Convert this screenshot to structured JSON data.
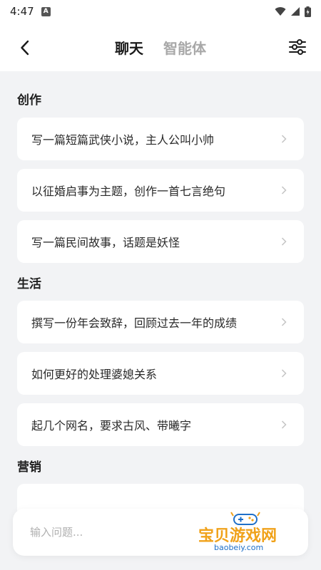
{
  "status_bar": {
    "time": "4:47",
    "sim_badge": "A"
  },
  "header": {
    "tabs": [
      {
        "label": "聊天",
        "active": true
      },
      {
        "label": "智能体",
        "active": false
      }
    ]
  },
  "sections": [
    {
      "title": "创作",
      "items": [
        "写一篇短篇武侠小说，主人公叫小帅",
        "以征婚启事为主题，创作一首七言绝句",
        "写一篇民间故事，话题是妖怪"
      ]
    },
    {
      "title": "生活",
      "items": [
        "撰写一份年会致辞，回顾过去一年的成绩",
        "如何更好的处理婆媳关系",
        "起几个网名，要求古风、带曦字"
      ]
    },
    {
      "title": "营销",
      "items": []
    }
  ],
  "input": {
    "placeholder": "输入问题..."
  },
  "watermark": {
    "title": "宝贝游戏网",
    "site": "baobeiy.com"
  },
  "colors": {
    "background": "#f2f3f5",
    "card": "#ffffff",
    "inactive_tab": "#a8a8a8",
    "watermark_orange": "#f0a21a",
    "watermark_blue": "#1e6fc8"
  }
}
